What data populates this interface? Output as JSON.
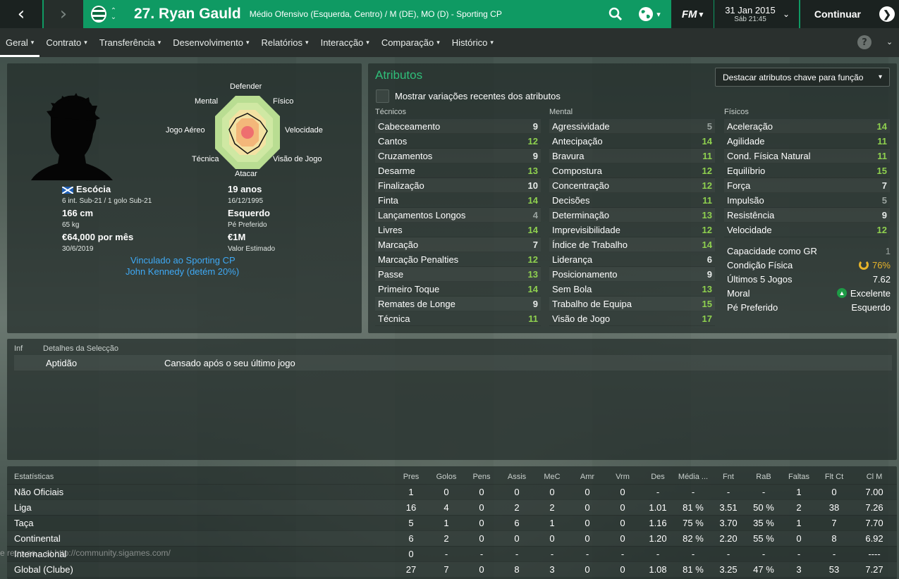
{
  "topbar": {
    "title": "27. Ryan Gauld",
    "subtitle": "Médio Ofensivo (Esquerda, Centro) / M (DE), MO (D) - Sporting CP",
    "brand": "FM",
    "date": "31 Jan 2015",
    "time": "Sáb 21:45",
    "continue_label": "Continuar",
    "accent_color": "#0f9a63"
  },
  "tabs": [
    {
      "label": "Geral",
      "active": true
    },
    {
      "label": "Contrato"
    },
    {
      "label": "Transferência"
    },
    {
      "label": "Desenvolvimento"
    },
    {
      "label": "Relatórios"
    },
    {
      "label": "Interacção"
    },
    {
      "label": "Comparação"
    },
    {
      "label": "Histórico"
    }
  ],
  "help_label": "?",
  "radar": {
    "labels": {
      "top": "Defender",
      "top_right": "Físico",
      "right": "Velocidade",
      "bottom_right": "Visão de Jogo",
      "bottom": "Atacar",
      "bottom_left": "Técnica",
      "left": "Jogo Aéreo",
      "top_left": "Mental"
    }
  },
  "profile": {
    "nation": "Escócia",
    "caps": "6 int. Sub-21 / 1 golo Sub-21",
    "height": "166 cm",
    "weight": "65 kg",
    "wage": "€64,000 por mês",
    "contract_end": "30/6/2019",
    "age": "19 anos",
    "dob": "16/12/1995",
    "foot": "Esquerdo",
    "foot_label": "Pé Preferido",
    "value": "€1M",
    "value_label": "Valor Estimado",
    "link1": "Vinculado ao Sporting CP",
    "link2": "John Kennedy (detém 20%)"
  },
  "attributes": {
    "title": "Atributos",
    "highlight_dropdown": "Destacar atributos chave para função",
    "show_changes_label": "Mostrar variações recentes dos atributos",
    "value_colors": {
      "high": "#8fd14f",
      "mid": "#e8ecea",
      "low": "#9aa39f"
    },
    "technical": {
      "header": "Técnicos",
      "items": [
        {
          "name": "Cabeceamento",
          "value": "9"
        },
        {
          "name": "Cantos",
          "value": "12"
        },
        {
          "name": "Cruzamentos",
          "value": "9"
        },
        {
          "name": "Desarme",
          "value": "13"
        },
        {
          "name": "Finalização",
          "value": "10"
        },
        {
          "name": "Finta",
          "value": "14"
        },
        {
          "name": "Lançamentos Longos",
          "value": "4"
        },
        {
          "name": "Livres",
          "value": "14"
        },
        {
          "name": "Marcação",
          "value": "7"
        },
        {
          "name": "Marcação Penalties",
          "value": "12"
        },
        {
          "name": "Passe",
          "value": "13"
        },
        {
          "name": "Primeiro Toque",
          "value": "14"
        },
        {
          "name": "Remates de Longe",
          "value": "9"
        },
        {
          "name": "Técnica",
          "value": "11"
        }
      ]
    },
    "mental": {
      "header": "Mental",
      "items": [
        {
          "name": "Agressividade",
          "value": "5"
        },
        {
          "name": "Antecipação",
          "value": "14"
        },
        {
          "name": "Bravura",
          "value": "11"
        },
        {
          "name": "Compostura",
          "value": "12"
        },
        {
          "name": "Concentração",
          "value": "12"
        },
        {
          "name": "Decisões",
          "value": "11"
        },
        {
          "name": "Determinação",
          "value": "13"
        },
        {
          "name": "Imprevisibilidade",
          "value": "12"
        },
        {
          "name": "Índice de Trabalho",
          "value": "14"
        },
        {
          "name": "Liderança",
          "value": "6"
        },
        {
          "name": "Posicionamento",
          "value": "9"
        },
        {
          "name": "Sem Bola",
          "value": "13"
        },
        {
          "name": "Trabalho de Equipa",
          "value": "15"
        },
        {
          "name": "Visão de Jogo",
          "value": "17"
        }
      ]
    },
    "physical": {
      "header": "Físicos",
      "items": [
        {
          "name": "Aceleração",
          "value": "14"
        },
        {
          "name": "Agilidade",
          "value": "11"
        },
        {
          "name": "Cond. Física Natural",
          "value": "11"
        },
        {
          "name": "Equilíbrio",
          "value": "15"
        },
        {
          "name": "Força",
          "value": "7"
        },
        {
          "name": "Impulsão",
          "value": "5"
        },
        {
          "name": "Resistência",
          "value": "9"
        },
        {
          "name": "Velocidade",
          "value": "12"
        }
      ]
    },
    "extras": [
      {
        "name": "Capacidade como GR",
        "value": "1"
      },
      {
        "name": "Condição Física",
        "value": "76%"
      },
      {
        "name": "Últimos 5 Jogos",
        "value": "7.62"
      },
      {
        "name": "Moral",
        "value": "Excelente"
      },
      {
        "name": "Pé Preferido",
        "value": "Esquerdo"
      }
    ]
  },
  "selection": {
    "col_inf": "Inf",
    "col_details": "Detalhes da Selecção",
    "row_label": "Aptidão",
    "row_value": "Cansado após o seu último jogo"
  },
  "stats": {
    "headers": [
      "Estatísticas",
      "Pres",
      "Golos",
      "Pens",
      "Assis",
      "MeC",
      "Amr",
      "Vrm",
      "Des",
      "Média ...",
      "Fnt",
      "RaB",
      "Faltas",
      "Flt Ct",
      "Cl M"
    ],
    "rows": [
      [
        "Não Oficiais",
        "1",
        "0",
        "0",
        "0",
        "0",
        "0",
        "0",
        "-",
        "-",
        "-",
        "-",
        "1",
        "0",
        "7.00"
      ],
      [
        "Liga",
        "16",
        "4",
        "0",
        "2",
        "2",
        "0",
        "0",
        "1.01",
        "81 %",
        "3.51",
        "50 %",
        "2",
        "38",
        "7.26"
      ],
      [
        "Taça",
        "5",
        "1",
        "0",
        "6",
        "1",
        "0",
        "0",
        "1.16",
        "75 %",
        "3.70",
        "35 %",
        "1",
        "7",
        "7.70"
      ],
      [
        "Continental",
        "6",
        "2",
        "0",
        "0",
        "0",
        "0",
        "0",
        "1.20",
        "82 %",
        "2.20",
        "55 %",
        "0",
        "8",
        "6.92"
      ],
      [
        "Internacional",
        "0",
        "-",
        "-",
        "-",
        "-",
        "-",
        "-",
        "-",
        "-",
        "-",
        "-",
        "-",
        "-",
        "----"
      ],
      [
        "Global (Clube)",
        "27",
        "7",
        "0",
        "8",
        "3",
        "0",
        "0",
        "1.08",
        "81 %",
        "3.25",
        "47 %",
        "3",
        "53",
        "7.27"
      ]
    ]
  },
  "watermark": "e retro sa... at http://community.sigames.com/"
}
